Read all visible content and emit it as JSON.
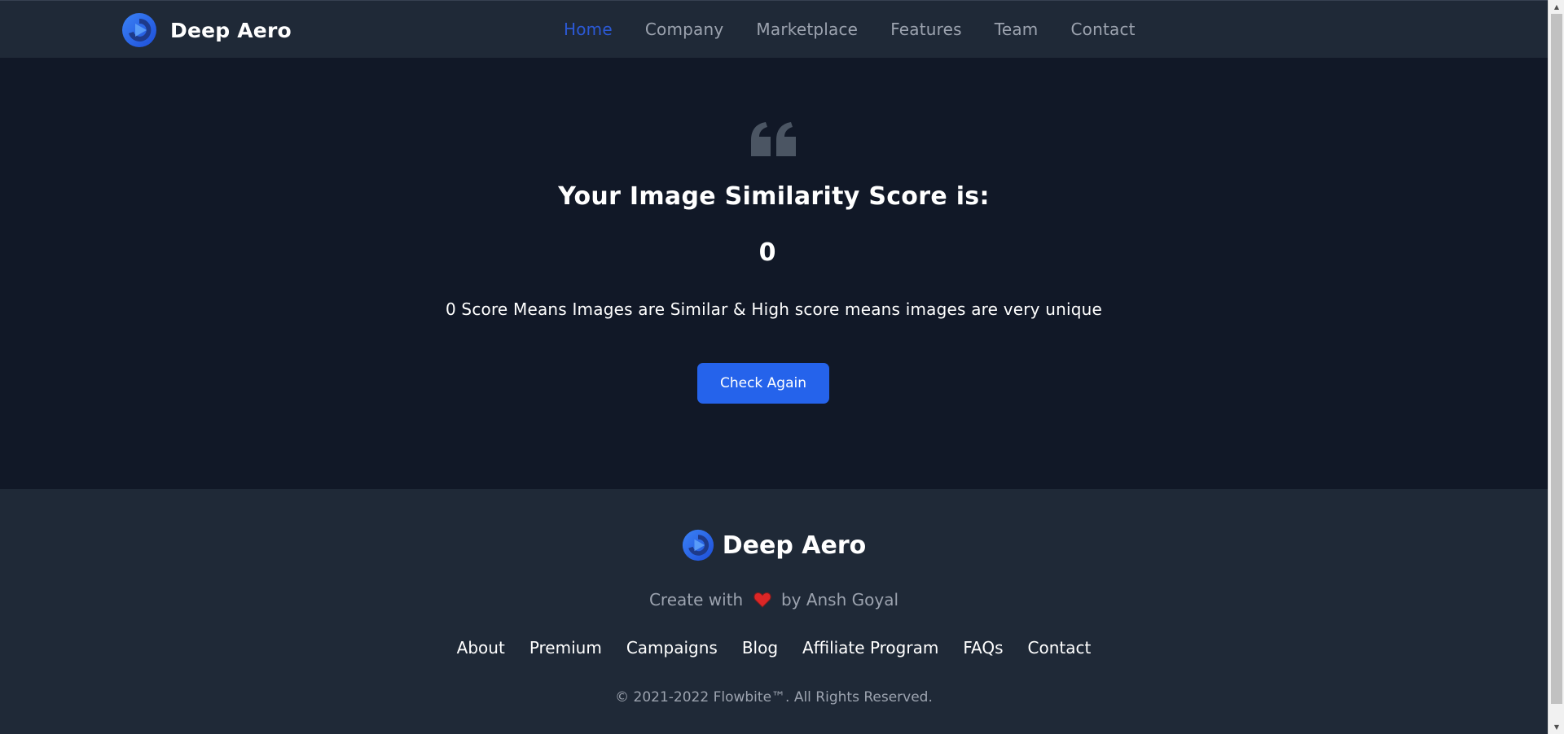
{
  "nav": {
    "brand": "Deep Aero",
    "items": [
      {
        "label": "Home",
        "active": true
      },
      {
        "label": "Company",
        "active": false
      },
      {
        "label": "Marketplace",
        "active": false
      },
      {
        "label": "Features",
        "active": false
      },
      {
        "label": "Team",
        "active": false
      },
      {
        "label": "Contact",
        "active": false
      }
    ]
  },
  "hero": {
    "quote_icon": "quote-icon",
    "title": "Your Image Similarity Score is:",
    "score": "0",
    "description": "0 Score Means Images are Similar & High score means images are very unique",
    "button_label": "Check Again"
  },
  "footer": {
    "brand": "Deep Aero",
    "made_with_prefix": "Create with",
    "made_with_suffix": "by Ansh Goyal",
    "heart_icon": "heart-icon",
    "links": [
      "About",
      "Premium",
      "Campaigns",
      "Blog",
      "Affiliate Program",
      "FAQs",
      "Contact"
    ],
    "copyright": "© 2021-2022 Flowbite™. All Rights Reserved."
  },
  "colors": {
    "nav_bg": "#1f2937",
    "hero_bg": "#111827",
    "accent": "#2563eb",
    "active_link": "#2b59d6",
    "muted_text": "#9ca3af"
  }
}
